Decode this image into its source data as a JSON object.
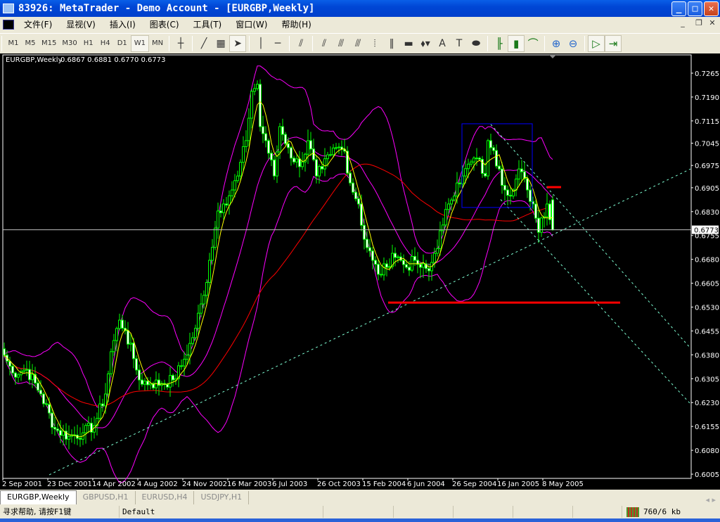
{
  "window": {
    "title": "83926: MetaTrader - Demo Account - [EURGBP,Weekly]",
    "minimize": "_",
    "maximize": "□",
    "close": "✕"
  },
  "menu": [
    "文件(F)",
    "显视(V)",
    "插入(I)",
    "图表(C)",
    "工具(T)",
    "窗口(W)",
    "帮助(H)"
  ],
  "mdi": {
    "minimize": "_",
    "restore": "❐",
    "close": "✕"
  },
  "toolbar": {
    "timeframes": [
      "M1",
      "M5",
      "M15",
      "M30",
      "H1",
      "H4",
      "D1",
      "W1",
      "MN"
    ],
    "active_timeframe": "W1",
    "tools": [
      {
        "name": "crosshair-icon",
        "glyph": "┼"
      },
      {
        "name": "trendline-icon",
        "glyph": "╱"
      },
      {
        "name": "fibo-grid-icon",
        "glyph": "▦"
      },
      {
        "name": "cursor-icon",
        "glyph": "➤"
      },
      {
        "name": "vertical-line-icon",
        "glyph": "│"
      },
      {
        "name": "horizontal-line-icon",
        "glyph": "─"
      },
      {
        "name": "pitchfork-icon",
        "glyph": "⫽"
      },
      {
        "name": "fibo-fan-icon",
        "glyph": "⫽"
      },
      {
        "name": "channel-icon",
        "glyph": "⫻"
      },
      {
        "name": "fibo-channel-icon",
        "glyph": "⫻"
      },
      {
        "name": "fibo-time-icon",
        "glyph": "⦙"
      },
      {
        "name": "cycle-lines-icon",
        "glyph": "‖"
      },
      {
        "name": "rectangle-icon",
        "glyph": "▬"
      },
      {
        "name": "arrows-icon",
        "glyph": "⬧▾"
      },
      {
        "name": "text-icon",
        "glyph": "A"
      },
      {
        "name": "label-icon",
        "glyph": "T"
      },
      {
        "name": "ellipse-icon",
        "glyph": "⬬"
      }
    ],
    "charts": [
      {
        "name": "bar-chart-icon",
        "glyph": "╟"
      },
      {
        "name": "candlestick-icon",
        "glyph": "▮"
      },
      {
        "name": "line-chart-icon",
        "glyph": "⌒"
      },
      {
        "name": "zoom-in-icon",
        "glyph": "⊕"
      },
      {
        "name": "zoom-out-icon",
        "glyph": "⊖"
      },
      {
        "name": "autoscroll-icon",
        "glyph": "▷"
      },
      {
        "name": "chart-shift-icon",
        "glyph": "⇥"
      }
    ]
  },
  "chart_data": {
    "type": "candlestick",
    "symbol_label": "EURGBP,Weekly",
    "ohlc_label": "0.6867 0.6881 0.6770 0.6773",
    "last_bar": {
      "open": 0.6867,
      "high": 0.6881,
      "low": 0.677,
      "close": 0.6773
    },
    "current_price": "0.6773",
    "y_ticks": [
      "0.7265",
      "0.7190",
      "0.7115",
      "0.7045",
      "0.6975",
      "0.6905",
      "0.6830",
      "0.6755",
      "0.6680",
      "0.6605",
      "0.6530",
      "0.6455",
      "0.6380",
      "0.6305",
      "0.6230",
      "0.6155",
      "0.6080",
      "0.6005"
    ],
    "ylim": [
      0.6005,
      0.7265
    ],
    "x_labels": [
      {
        "week": 0,
        "text": "2 Sep 2001"
      },
      {
        "week": 16,
        "text": "23 Dec 2001"
      },
      {
        "week": 32,
        "text": "14 Apr 2002"
      },
      {
        "week": 48,
        "text": "4 Aug 2002"
      },
      {
        "week": 64,
        "text": "24 Nov 2002"
      },
      {
        "week": 80,
        "text": "16 Mar 2003"
      },
      {
        "week": 96,
        "text": "6 Jul 2003"
      },
      {
        "week": 112,
        "text": "26 Oct 2003"
      },
      {
        "week": 128,
        "text": "15 Feb 2004"
      },
      {
        "week": 144,
        "text": "6 Jun 2004"
      },
      {
        "week": 160,
        "text": "26 Sep 2004"
      },
      {
        "week": 176,
        "text": "16 Jan 2005"
      },
      {
        "week": 192,
        "text": "8 May 2005"
      }
    ],
    "bars": 196,
    "close_keypoints": [
      [
        0,
        0.6379
      ],
      [
        3,
        0.6323
      ],
      [
        8,
        0.6334
      ],
      [
        13,
        0.6257
      ],
      [
        18,
        0.6147
      ],
      [
        23,
        0.6124
      ],
      [
        28,
        0.6135
      ],
      [
        32,
        0.6158
      ],
      [
        36,
        0.6257
      ],
      [
        38,
        0.639
      ],
      [
        41,
        0.6489
      ],
      [
        43,
        0.6456
      ],
      [
        46,
        0.6368
      ],
      [
        48,
        0.6301
      ],
      [
        52,
        0.629
      ],
      [
        56,
        0.629
      ],
      [
        60,
        0.6301
      ],
      [
        63,
        0.6345
      ],
      [
        67,
        0.6434
      ],
      [
        71,
        0.6567
      ],
      [
        73,
        0.6677
      ],
      [
        76,
        0.6832
      ],
      [
        78,
        0.6854
      ],
      [
        81,
        0.6898
      ],
      [
        83,
        0.6942
      ],
      [
        86,
        0.7053
      ],
      [
        88,
        0.7208
      ],
      [
        90,
        0.723
      ],
      [
        91,
        0.7097
      ],
      [
        93,
        0.7053
      ],
      [
        96,
        0.6942
      ],
      [
        98,
        0.7097
      ],
      [
        101,
        0.7031
      ],
      [
        103,
        0.6986
      ],
      [
        106,
        0.6986
      ],
      [
        108,
        0.7053
      ],
      [
        111,
        0.6942
      ],
      [
        113,
        0.6964
      ],
      [
        116,
        0.7009
      ],
      [
        118,
        0.7031
      ],
      [
        121,
        0.702
      ],
      [
        123,
        0.692
      ],
      [
        126,
        0.6854
      ],
      [
        128,
        0.6743
      ],
      [
        131,
        0.6677
      ],
      [
        133,
        0.6633
      ],
      [
        136,
        0.6655
      ],
      [
        138,
        0.6699
      ],
      [
        141,
        0.6677
      ],
      [
        143,
        0.6655
      ],
      [
        146,
        0.6677
      ],
      [
        148,
        0.6655
      ],
      [
        151,
        0.6644
      ],
      [
        153,
        0.6699
      ],
      [
        156,
        0.6788
      ],
      [
        158,
        0.6854
      ],
      [
        161,
        0.692
      ],
      [
        163,
        0.6942
      ],
      [
        166,
        0.6986
      ],
      [
        168,
        0.6998
      ],
      [
        171,
        0.6942
      ],
      [
        172,
        0.7053
      ],
      [
        173,
        0.7031
      ],
      [
        176,
        0.6964
      ],
      [
        178,
        0.6898
      ],
      [
        181,
        0.6898
      ],
      [
        183,
        0.6964
      ],
      [
        186,
        0.6898
      ],
      [
        188,
        0.6854
      ],
      [
        190,
        0.6765
      ],
      [
        191,
        0.681
      ],
      [
        193,
        0.6854
      ],
      [
        195,
        0.6773
      ]
    ],
    "indicators": [
      {
        "name": "fast-ma",
        "period": 5,
        "color": "#ffff00"
      },
      {
        "name": "slow-ma",
        "period": 55,
        "color": "#ff0000"
      },
      {
        "name": "bollinger",
        "period": 20,
        "deviation": 2,
        "color": "#ff00ff"
      }
    ],
    "objects": {
      "trendline": {
        "p1": [
          16,
          0.6003
        ],
        "p2": [
          244,
          0.6964
        ],
        "color": "#7fffd4"
      },
      "channel_lines": [
        {
          "p1": [
            173,
            0.7104
          ],
          "p2": [
            244,
            0.6401
          ]
        },
        {
          "p1": [
            176.5,
            0.6868
          ],
          "p2": [
            244,
            0.6226
          ]
        }
      ],
      "rectangle": {
        "w1": 162.75,
        "w2": 187.75,
        "p1": 0.7106,
        "p2": 0.6843,
        "color": "#0000ff"
      },
      "support_line": {
        "w1": 136.5,
        "w2": 219,
        "price": 0.6544,
        "color": "#ff0000"
      },
      "resistance_mark": {
        "w1": 193,
        "w2": 198,
        "price": 0.6907,
        "color": "#ff0000"
      }
    },
    "colors": {
      "background": "#000000",
      "candle": "#00ff00",
      "grid_text": "#ffffff",
      "price_line": "#c0c0c0"
    }
  },
  "tabs": [
    {
      "label": "EURGBP,Weekly",
      "active": true
    },
    {
      "label": "GBPUSD,H1"
    },
    {
      "label": "EURUSD,H4"
    },
    {
      "label": "USDJPY,H1"
    }
  ],
  "status": {
    "help": "寻求帮助, 请按F1键",
    "profile": "Default",
    "traffic": "760/6 kb"
  }
}
